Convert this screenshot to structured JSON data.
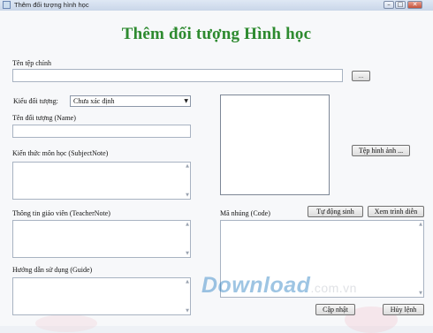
{
  "window": {
    "title": "Thêm đối tượng hình học",
    "buttons": {
      "minimize": "–",
      "maximize": "□",
      "close": "✕"
    }
  },
  "heading": "Thêm đối tượng Hình học",
  "file": {
    "label": "Tên tệp chính",
    "value": "",
    "browse_label": "..."
  },
  "object_type": {
    "label": "Kiểu đối tượng:",
    "selected": "Chưa xác định"
  },
  "object_name": {
    "label": "Tên đối tượng (Name)",
    "value": ""
  },
  "subject_note": {
    "label": "Kiến thức môn học (SubjectNote)",
    "value": ""
  },
  "teacher_note": {
    "label": "Thông tin giáo viên (TeacherNote)",
    "value": ""
  },
  "guide": {
    "label": "Hướng dẫn sử dụng (Guide)",
    "value": ""
  },
  "image": {
    "button_label": "Tệp hình ảnh ..."
  },
  "embed_code": {
    "label": "Mã nhúng (Code)",
    "auto_gen_label": "Tự động sinh",
    "preview_label": "Xem trình diễn",
    "value": ""
  },
  "actions": {
    "update_label": "Cập nhật",
    "cancel_label": "Hủy lệnh"
  },
  "watermark": {
    "brand": "Download",
    "suffix": ".com.vn"
  },
  "colors": {
    "heading": "#2d8a2f",
    "watermark": "#2a7fc3"
  }
}
